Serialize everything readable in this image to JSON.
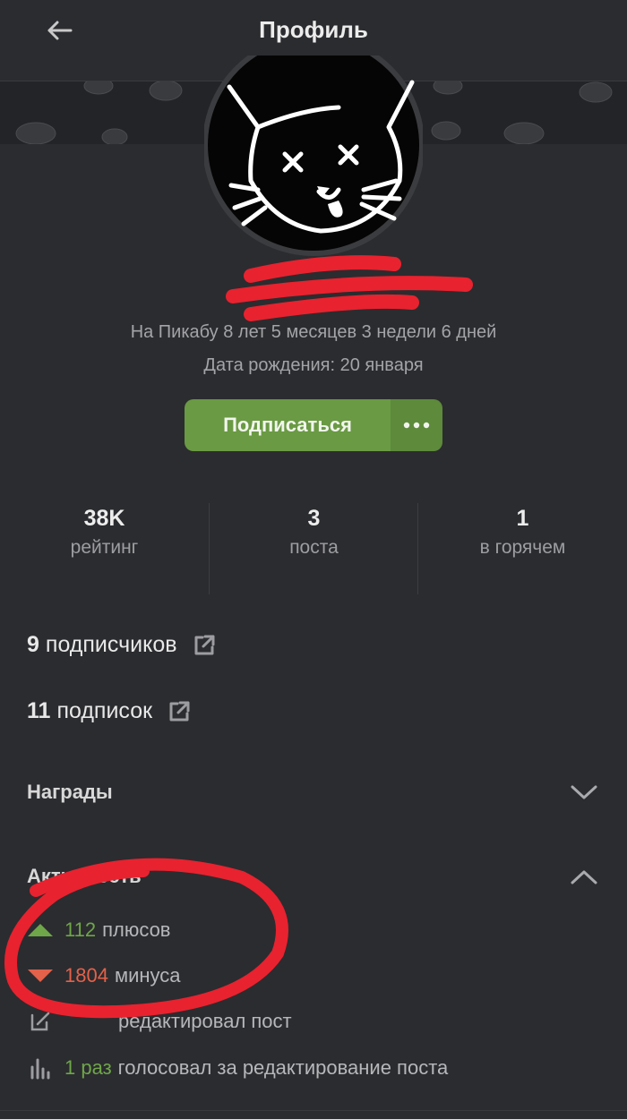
{
  "header": {
    "title": "Профиль"
  },
  "profile": {
    "on_site": "На Пикабу 8 лет 5 месяцев 3 недели 6 дней",
    "birthday": "Дата рождения: 20 января",
    "subscribe_label": "Подписаться"
  },
  "stats": [
    {
      "value": "38K",
      "label": "рейтинг"
    },
    {
      "value": "3",
      "label": "поста"
    },
    {
      "value": "1",
      "label": "в горячем"
    }
  ],
  "followers": {
    "count": "9",
    "label": "подписчиков"
  },
  "subscriptions": {
    "count": "11",
    "label": "подписок"
  },
  "sections": {
    "awards": "Награды",
    "activity": "Активность"
  },
  "activity": {
    "plus_count": "112",
    "plus_label": "плюсов",
    "minus_count": "1804",
    "minus_label": "минуса",
    "edit_text": "редактировал пост",
    "vote_count": "1 раз",
    "vote_text": "голосовал за редактирование поста"
  },
  "colors": {
    "background": "#2b2c2f",
    "accent_green": "#6a9a44",
    "minus_red": "#e4614a",
    "marker_red": "#e8222f"
  },
  "icons": [
    "back-arrow-icon",
    "more-dots-icon",
    "external-link-icon",
    "chevron-down-icon",
    "chevron-up-icon",
    "triangle-up-icon",
    "triangle-down-icon",
    "edit-icon",
    "bar-chart-icon"
  ]
}
